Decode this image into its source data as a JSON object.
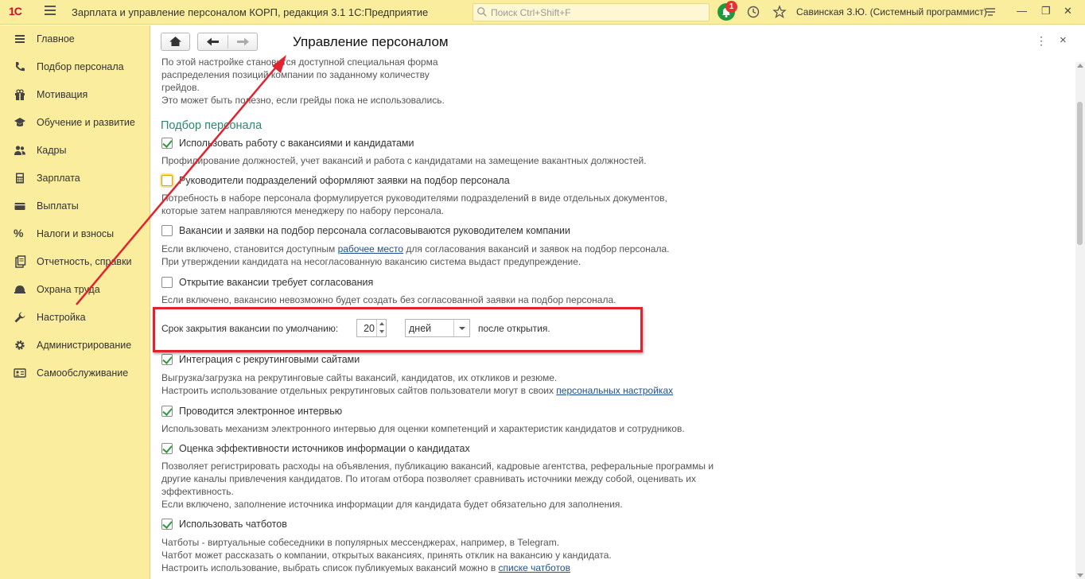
{
  "titlebar": {
    "logo": "1С",
    "app_title": "Зарплата и управление персоналом КОРП, редакция 3.1 1С:Предприятие",
    "search_placeholder": "Поиск Ctrl+Shift+F",
    "notification_count": "1",
    "user": "Савинская З.Ю. (Системный программист)",
    "icons": [
      "menu-icon",
      "search-icon",
      "bell-icon",
      "history-icon",
      "star-icon",
      "settings-icon",
      "minimize-icon",
      "restore-icon",
      "close-icon"
    ]
  },
  "sidebar": {
    "items": [
      {
        "label": "Главное",
        "icon": "list-icon"
      },
      {
        "label": "Подбор персонала",
        "icon": "phone-icon"
      },
      {
        "label": "Мотивация",
        "icon": "gift-icon"
      },
      {
        "label": "Обучение и развитие",
        "icon": "graduation-icon"
      },
      {
        "label": "Кадры",
        "icon": "people-icon"
      },
      {
        "label": "Зарплата",
        "icon": "calculator-icon"
      },
      {
        "label": "Выплаты",
        "icon": "wallet-icon"
      },
      {
        "label": "Налоги и взносы",
        "icon": "percent-icon"
      },
      {
        "label": "Отчетность, справки",
        "icon": "report-icon"
      },
      {
        "label": "Охрана труда",
        "icon": "helmet-icon"
      },
      {
        "label": "Настройка",
        "icon": "wrench-icon"
      },
      {
        "label": "Администрирование",
        "icon": "gear-icon"
      },
      {
        "label": "Самообслуживание",
        "icon": "id-card-icon"
      }
    ]
  },
  "page": {
    "title": "Управление персоналом",
    "more_label": "⋮",
    "close_label": "×"
  },
  "form": {
    "intro_lines": [
      "По этой настройке становится доступной специальная форма",
      "распределения позиций компании по заданному количеству",
      "грейдов.",
      "Это может быть полезно, если грейды пока не использовались."
    ],
    "section_title": "Подбор персонала",
    "opt_vacancies": {
      "label": "Использовать работу с вакансиями и кандидатами",
      "checked": true,
      "desc": [
        "Профилирование должностей, учет вакансий и работа с кандидатами на замещение вакантных должностей."
      ]
    },
    "opt_managers": {
      "label": "Руководители подразделений оформляют заявки на подбор персонала",
      "checked": false,
      "desc": [
        "Потребность в наборе персонала формулируется руководителями подразделений в виде отдельных документов,",
        "которые затем направляются менеджеру по набору персонала."
      ]
    },
    "opt_head_approve": {
      "label": "Вакансии и заявки на подбор персонала согласовываются руководителем компании",
      "checked": false,
      "desc_pre": "Если включено, становится доступным ",
      "desc_link": "рабочее место",
      "desc_post": " для согласования вакансий и заявок на подбор персонала.",
      "desc2": "При утверждении кандидата на несогласованную вакансию система выдаст предупреждение."
    },
    "opt_open_approve": {
      "label": "Открытие вакансии требует согласования",
      "checked": false,
      "desc": [
        "Если включено, вакансию невозможно будет создать без согласованной заявки на подбор персонала."
      ]
    },
    "close_term": {
      "label": "Срок закрытия вакансии по умолчанию:",
      "value": "20",
      "unit": "дней",
      "after": "после открытия."
    },
    "opt_recruit_sites": {
      "label": "Интеграция с рекрутинговыми сайтами",
      "checked": true,
      "desc1": "Выгрузка/загрузка на рекрутинговые сайты вакансий, кандидатов, их откликов и резюме.",
      "desc2_pre": "Настроить использование отдельных рекрутинговых сайтов пользователи могут в своих ",
      "desc2_link": "персональных настройках"
    },
    "opt_interview": {
      "label": "Проводится электронное интервью",
      "checked": true,
      "desc": [
        "Использовать механизм электронного интервью для оценки компетенций и характеристик кандидатов и сотрудников."
      ]
    },
    "opt_sources": {
      "label": "Оценка эффективности источников информации о кандидатах",
      "checked": true,
      "desc": [
        "Позволяет регистрировать расходы на объявления, публикацию вакансий, кадровые агентства, реферальные программы и",
        "другие каналы привлечения кандидатов. По итогам отбора позволяет сравнивать источники между собой, оценивать их",
        "эффективность.",
        "Если включено, заполнение источника информации для кандидата будет обязательно для заполнения."
      ]
    },
    "opt_chatbot": {
      "label": "Использовать чатботов",
      "checked": true,
      "desc": [
        "Чатботы - виртуальные собеседники в популярных мессенджерах, например, в Telegram.",
        "Чатбот может рассказать о компании, открытых вакансиях, принять отклик на вакансию у кандидата."
      ],
      "desc_last_pre": "Настроить использование, выбрать список публикуемых вакансий можно в ",
      "desc_last_link": "списке чатботов"
    }
  },
  "colors": {
    "sidebar_bg": "#fbed9e",
    "section_title": "#2a8a6e",
    "annotation_red": "#e0232e",
    "check_green": "#2e9a3e"
  }
}
